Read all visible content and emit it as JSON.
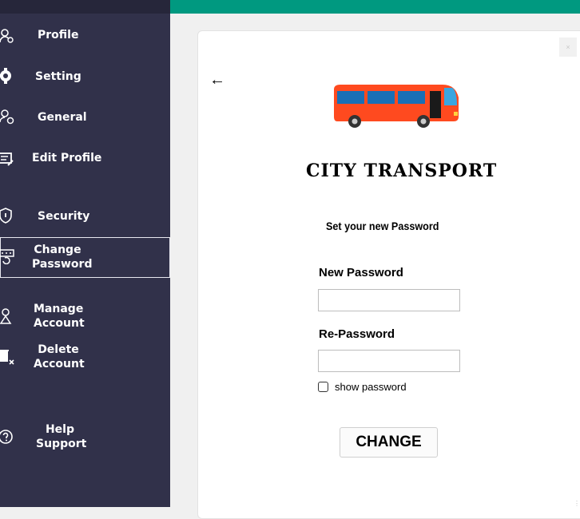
{
  "sidebar": {
    "items": [
      {
        "label": "Profile",
        "icon": "profile-icon"
      },
      {
        "label": "Setting",
        "icon": "gear-icon"
      },
      {
        "label": "General",
        "icon": "general-settings-icon"
      },
      {
        "label": "Edit Profile",
        "icon": "edit-profile-icon"
      },
      {
        "label": "Security",
        "icon": "shield-icon"
      },
      {
        "label": "Change Password",
        "icon": "password-reset-icon",
        "active": true
      },
      {
        "label": "Manage Account",
        "icon": "manage-account-icon"
      },
      {
        "label": "Delete Account",
        "icon": "delete-account-icon"
      },
      {
        "label": "Help Support",
        "icon": "help-icon"
      }
    ]
  },
  "colors": {
    "sidebar": "#31314a",
    "topbar": "#009980",
    "bus": "#ff4a1f",
    "card": "#ffffff"
  },
  "card": {
    "close_label": "×",
    "back_icon": "back-arrow-icon",
    "logo_icon": "bus-icon",
    "title": "CITY TRANSPORT",
    "subtitle": "Set your new Password",
    "new_password_label": "New Password",
    "new_password_value": "",
    "re_password_label": "Re-Password",
    "re_password_value": "",
    "show_password_label": "show password",
    "show_password_checked": false,
    "change_button": "CHANGE"
  }
}
